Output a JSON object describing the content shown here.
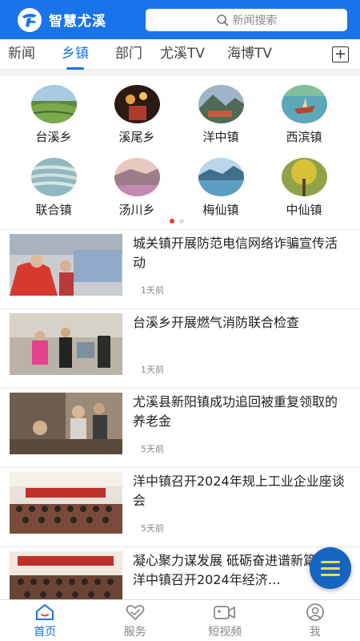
{
  "header": {
    "app_title": "智慧尤溪",
    "search_placeholder": "新闻搜索"
  },
  "tabs": [
    {
      "label": "新闻",
      "active": false
    },
    {
      "label": "乡镇",
      "active": true
    },
    {
      "label": "部门",
      "active": false
    },
    {
      "label": "尤溪TV",
      "active": false
    },
    {
      "label": "海博TV",
      "active": false
    }
  ],
  "towns": [
    {
      "name": "台溪乡",
      "image": "tea-field-photo"
    },
    {
      "name": "溪尾乡",
      "image": "lantern-performance-photo"
    },
    {
      "name": "洋中镇",
      "image": "mountain-village-photo"
    },
    {
      "name": "西滨镇",
      "image": "river-boat-photo"
    },
    {
      "name": "联合镇",
      "image": "terraced-fields-photo"
    },
    {
      "name": "汤川乡",
      "image": "flower-hills-photo"
    },
    {
      "name": "梅仙镇",
      "image": "lake-view-photo"
    },
    {
      "name": "中仙镇",
      "image": "autumn-tree-photo"
    }
  ],
  "carousel": {
    "page": 1,
    "total": 2
  },
  "news": [
    {
      "title": "城关镇开展防范电信网络诈骗宣传活动",
      "time": "1天前",
      "image": "street-publicity-photo"
    },
    {
      "title": "台溪乡开展燃气消防联合检查",
      "time": "1天前",
      "image": "inspection-room-photo"
    },
    {
      "title": "尤溪县新阳镇成功追回被重复领取的养老金",
      "time": "5天前",
      "image": "home-visit-photo"
    },
    {
      "title": "洋中镇召开2024年规上工业企业座谈会",
      "time": "5天前",
      "image": "meeting-hall-photo"
    },
    {
      "title": "凝心聚力谋发展 砥砺奋进谱新篇——洋中镇召开2024年经济…",
      "time": "",
      "image": "conference-photo"
    }
  ],
  "bottom_nav": [
    {
      "label": "首页",
      "icon": "home-icon",
      "active": true
    },
    {
      "label": "服务",
      "icon": "heart-hands-icon",
      "active": false
    },
    {
      "label": "短视频",
      "icon": "video-camera-icon",
      "active": false
    },
    {
      "label": "我",
      "icon": "user-icon",
      "active": false
    }
  ],
  "colors": {
    "brand": "#1a73e8",
    "carousel_dot_active": "#e53935",
    "fab": "#1565c0"
  }
}
